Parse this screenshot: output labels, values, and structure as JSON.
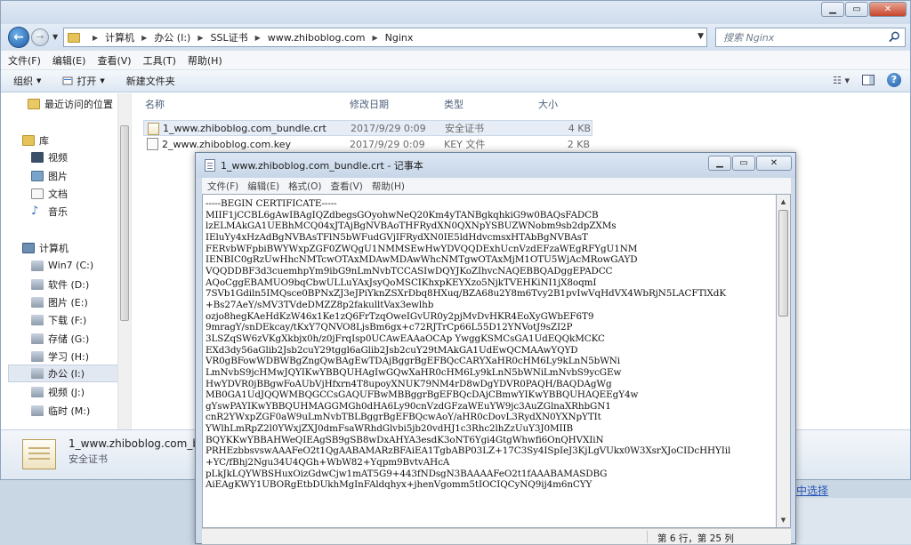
{
  "explorer": {
    "address": [
      "计算机",
      "办公 (I:)",
      "SSL证书",
      "www.zhiboblog.com",
      "Nginx"
    ],
    "search_placeholder": "搜索 Nginx",
    "menu": [
      "文件(F)",
      "编辑(E)",
      "查看(V)",
      "工具(T)",
      "帮助(H)"
    ],
    "toolbar": {
      "organize": "组织",
      "open": "打开",
      "new_folder": "新建文件夹"
    },
    "sidebar": {
      "recent": "最近访问的位置",
      "library": "库",
      "library_items": [
        "视频",
        "图片",
        "文档",
        "音乐"
      ],
      "computer": "计算机",
      "drives": [
        "Win7 (C:)",
        "软件 (D:)",
        "图片 (E:)",
        "下载 (F:)",
        "存储 (G:)",
        "学习 (H:)",
        "办公 (I:)",
        "视频 (J:)",
        "临时 (M:)"
      ]
    },
    "columns": {
      "name": "名称",
      "date": "修改日期",
      "type": "类型",
      "size": "大小"
    },
    "files": [
      {
        "name": "1_www.zhiboblog.com_bundle.crt",
        "date": "2017/9/29 0:09",
        "type": "安全证书",
        "size": "4 KB"
      },
      {
        "name": "2_www.zhiboblog.com.key",
        "date": "2017/9/29 0:09",
        "type": "KEY 文件",
        "size": "2 KB"
      }
    ],
    "status": {
      "name": "1_www.zhiboblog.com_bundle.crt",
      "type": "安全证书"
    }
  },
  "background": {
    "link": "中选择"
  },
  "notepad": {
    "title": "1_www.zhiboblog.com_bundle.crt - 记事本",
    "menu": [
      "文件(F)",
      "编辑(E)",
      "格式(O)",
      "查看(V)",
      "帮助(H)"
    ],
    "lines": [
      "-----BEGIN CERTIFICATE-----",
      "MIIF1jCCBL6gAwIBAgIQZdbegsGOyohwNeQ20Km4yTANBgkqhkiG9w0BAQsFADCB",
      "lzELMAkGA1UEBhMCQ04xJTAjBgNVBAoTHFRydXN0QXNpYSBUZWNobm9sb2dpZXMs",
      "IEluYy4xHzAdBgNVBAsTFlN5bWFudGVjIFRydXN0IE5ldHdvcmsxHTAbBgNVBAsT",
      "FERvbWFpbiBWYWxpZGF0ZWQgU1NMMSEwHwYDVQQDExhUcnVzdEFzaWEgRFYgU1NM",
      "IENBIC0gRzUwHhcNMTcwOTAxMDAwMDAwWhcNMTgwOTAxMjM1OTU5WjAcMRowGAYD",
      "VQQDDBF3d3cuemhpYm9ibG9nLmNvbTCCASIwDQYJKoZIhvcNAQEBBQADggEPADCC",
      "AQoCggEBAMUO9bqCbwULLuYAxJsyQoMSCIKhxpKEYXzo5NjkTVEHKiNI1jX8oqmI",
      "7SVb1Gdiln5IMQsce0BPNxZJ3eJPiYknZSXrDbq8HXuq/BZA68u2Y8m6Tvy2B1pvIwVqHdVX4WbRjN5LACFTlXdK",
      "+Bs27AeY/sMV3TVdeDMZZ8p2fakulltVax3ewlhb",
      "ozjo8hegKAeHdKzW46x1Ke1zQ6FrTzqOweIGvUR0y2pjMvDvHKR4EoXyGWbEF6T9",
      "9mragY/snDEkcay/tKxY7QNVO8LjsBm6gx+c72RJTrCp66L55D12YNVotJ9sZI2P",
      "3LSZqSW6zVKgXkbjx0h/z0jFrqIsp0UCAwEAAaOCAp YwggKSMCsGA1UdEQQkMCKC",
      "EXd3dy56aGlib2Jsb2cuY29tggl6aGlib2Jsb2cuY29tMAkGA1UdEwQCMAAwYQYD",
      "VR0gBFowWDBWBgZngQwBAgEwTDAjBggrBgEFBQcCARYXaHR0cHM6Ly9kLnN5bWNi",
      "LmNvbS9jcHMwJQYIKwYBBQUHAgIwGQwXaHR0cHM6Ly9kLnN5bWNiLmNvbS9ycGEw",
      "HwYDVR0jBBgwFoAUbVjHfxrn4T8upoyXNUK79NM4rD8wDgYDVR0PAQH/BAQDAgWg",
      "MB0GA1UdJQQWMBQGCCsGAQUFBwMBBggrBgEFBQcDAjCBmwYIKwYBBQUHAQEEgY4w",
      "gYswPAYIKwYBBQUHMAGGMGh0dHA6Ly90cnVzdGFzaWEuYW9jc3AuZGlnaXRhbGN1",
      "cnR2YWxpZGF0aW9uLmNvbTBLBggrBgEFBQcwAoY/aHR0cDovL3RydXN0YXNpYTIt",
      "YWlhLmRpZ2l0YWxjZXJ0dmFsaWRhdGlvbi5jb20vdHJ1c3Rhc2lhZzUuY3J0MIIB",
      "BQYKKwYBBAHWeQIEAgSB9gSB8wDxAHYA3esdK3oNT6Ygi4GtgWhwfi6OnQHVXIiN",
      "PRHEzbbsvswAAAFeO2t1QgAABAMARzBFAiEA1TgbABP03LZ+17C3Sy4ISpIeJ3KjLgVUkx0W3XsrXJoCIDcHHYIil",
      "+YC/fBhj2Ngu34U4QGh+WbW82+Yqpm9BvtvAHcA",
      "pLkJkLQYWBSHuxOizGdwCjw1mAT5G9+443fNDsgN3BAAAAFeO2t1fAAABAMASDBG",
      "AiEAgKWY1UBORgEtbDUkhMgInFAldqhyx+jhenVgomm5tIOCIQCyNQ9ij4m6nCYY"
    ],
    "status_pos": "第 6 行，第 25 列"
  }
}
